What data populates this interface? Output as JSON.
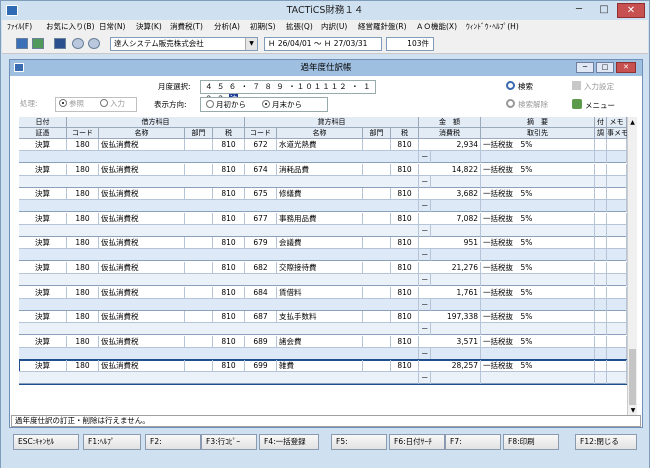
{
  "window": {
    "title": "TACTiCS財務１４",
    "min": "─",
    "max": "□",
    "close": "✕"
  },
  "menu": [
    "ﾌｧｲﾙ(F)",
    "お気に入り(B)",
    "日常(N)",
    "決算(K)",
    "消費税(T)",
    "分析(A)",
    "初期(S)",
    "拡張(Q)",
    "内訳(U)",
    "経営羅針盤(R)",
    "ＡＯ機能(X)",
    "ｳｨﾝﾄﾞｳ･ﾍﾙﾌﾟ(H)"
  ],
  "toolbar": {
    "company": "達人システム販売株式会社",
    "period": "Ｈ 26/04/01 ～ Ｈ 27/03/31",
    "count": "103件",
    "combo_arrow": "▼"
  },
  "inner": {
    "title": "過年度仕訳帳",
    "min": "─",
    "max": "□",
    "close": "✕"
  },
  "controls": {
    "month_label": "月度選択:",
    "months": "４ ５ ６ ・ ７ ８ ９ ・１０１１１２ ・ １ ２ ３",
    "month_selected": "決",
    "mode_label": "処理:",
    "mode_ref": "参照",
    "mode_input": "入力",
    "dir_label": "表示方向:",
    "dir_first": "月初から",
    "dir_last": "月末から",
    "search": "検索",
    "search_clear": "検索解除",
    "input_settings": "入力設定",
    "menu": "メニュー"
  },
  "headers": {
    "row1": [
      "日付",
      "借方科目",
      "貸方科目",
      "金　額",
      "摘　要",
      "付",
      "メモ"
    ],
    "row2": [
      "証憑",
      "コード",
      "名称",
      "部門",
      "税",
      "コード",
      "名称",
      "部門",
      "税",
      "消費税",
      "取引先",
      "調",
      "事メモ"
    ]
  },
  "rows": [
    {
      "date": "決算",
      "dcode": "180",
      "dname": "仮払消費税",
      "dtax": "810",
      "ccode": "672",
      "cname": "水道光熱費",
      "ctax": "810",
      "amount": "2,934",
      "memo": "一括税抜　5%",
      "sub": "－"
    },
    {
      "date": "決算",
      "dcode": "180",
      "dname": "仮払消費税",
      "dtax": "810",
      "ccode": "674",
      "cname": "消耗品費",
      "ctax": "810",
      "amount": "14,822",
      "memo": "一括税抜　5%",
      "sub": "－"
    },
    {
      "date": "決算",
      "dcode": "180",
      "dname": "仮払消費税",
      "dtax": "810",
      "ccode": "675",
      "cname": "修繕費",
      "ctax": "810",
      "amount": "3,682",
      "memo": "一括税抜　5%",
      "sub": "－"
    },
    {
      "date": "決算",
      "dcode": "180",
      "dname": "仮払消費税",
      "dtax": "810",
      "ccode": "677",
      "cname": "事務用品費",
      "ctax": "810",
      "amount": "7,082",
      "memo": "一括税抜　5%",
      "sub": "－"
    },
    {
      "date": "決算",
      "dcode": "180",
      "dname": "仮払消費税",
      "dtax": "810",
      "ccode": "679",
      "cname": "会議費",
      "ctax": "810",
      "amount": "951",
      "memo": "一括税抜　5%",
      "sub": "－"
    },
    {
      "date": "決算",
      "dcode": "180",
      "dname": "仮払消費税",
      "dtax": "810",
      "ccode": "682",
      "cname": "交際接待費",
      "ctax": "810",
      "amount": "21,276",
      "memo": "一括税抜　5%",
      "sub": "－"
    },
    {
      "date": "決算",
      "dcode": "180",
      "dname": "仮払消費税",
      "dtax": "810",
      "ccode": "684",
      "cname": "賃借料",
      "ctax": "810",
      "amount": "1,761",
      "memo": "一括税抜　5%",
      "sub": "－"
    },
    {
      "date": "決算",
      "dcode": "180",
      "dname": "仮払消費税",
      "dtax": "810",
      "ccode": "687",
      "cname": "支払手数料",
      "ctax": "810",
      "amount": "197,338",
      "memo": "一括税抜　5%",
      "sub": "－"
    },
    {
      "date": "決算",
      "dcode": "180",
      "dname": "仮払消費税",
      "dtax": "810",
      "ccode": "689",
      "cname": "諸会費",
      "ctax": "810",
      "amount": "3,571",
      "memo": "一括税抜　5%",
      "sub": "－"
    },
    {
      "date": "決算",
      "dcode": "180",
      "dname": "仮払消費税",
      "dtax": "810",
      "ccode": "699",
      "cname": "雑費",
      "ctax": "810",
      "amount": "28,257",
      "memo": "一括税抜　5%",
      "sub": "－"
    }
  ],
  "scroll": {
    "up": "▲",
    "down": "▼"
  },
  "status": "過年度仕訳の訂正・削除は行えません。",
  "fkeys": [
    "ESC:ｷｬﾝｾﾙ",
    "F1:ﾍﾙﾌﾟ",
    "F2:",
    "F3:行ｺﾋﾟｰ",
    "F4:一括登録",
    "F5:",
    "F6:日付ｻｰﾁ",
    "F7:",
    "F8:印刷",
    "F12:閉じる"
  ]
}
